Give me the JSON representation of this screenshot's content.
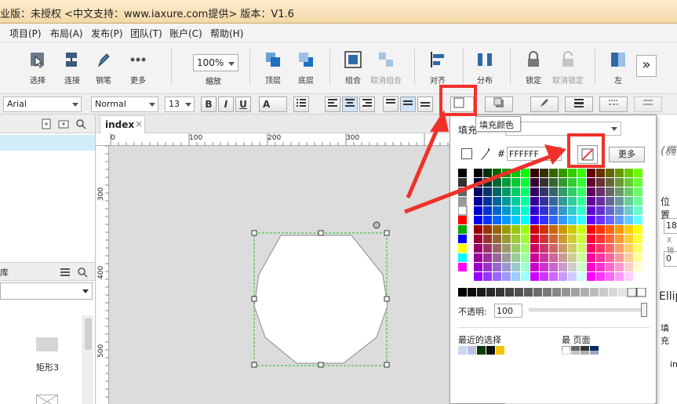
{
  "title": "业版：未授权    <中文支持：www.iaxure.com提供> 版本：V1.6",
  "menu": [
    "项目(P)",
    "布局(A)",
    "发布(P)",
    "团队(T)",
    "账户(C)",
    "帮助(H)"
  ],
  "toolbar": {
    "select": "选择",
    "connect": "连接",
    "pen": "钢笔",
    "more": "更多",
    "zoom_value": "100%",
    "zoom": "缩放",
    "top": "顶层",
    "bottom": "底层",
    "group": "组合",
    "ungroup": "取消组合",
    "align": "对齐",
    "distribute": "分布",
    "lock": "锁定",
    "unlock": "取消锁定",
    "left": "左"
  },
  "format": {
    "font": "Arial",
    "style": "Normal",
    "size": "13"
  },
  "left_panel": {
    "icon_label": "矩形3",
    "section_label": "库"
  },
  "canvas": {
    "tab": "index",
    "ruler_top": [
      "0",
      "100",
      "200",
      "300"
    ],
    "ruler_left": [
      "300",
      "400",
      "500"
    ]
  },
  "popup": {
    "fill_label": "填充",
    "tooltip": "填充颜色",
    "hash": "#",
    "hex_value": "FFFFFF",
    "more": "更多",
    "opacity_label": "不透明:",
    "opacity_value": "100",
    "recent": "最近的选择",
    "page": "最   页面"
  },
  "right_panel": {
    "items": [
      "(椭",
      "位置",
      "18",
      "X轴",
      "0",
      "Ellip",
      "填充",
      "in"
    ]
  },
  "colors": {
    "accent_red": "#f0312a",
    "selection_green": "#25c125",
    "toolbar_bg": "#f3f3f3"
  }
}
